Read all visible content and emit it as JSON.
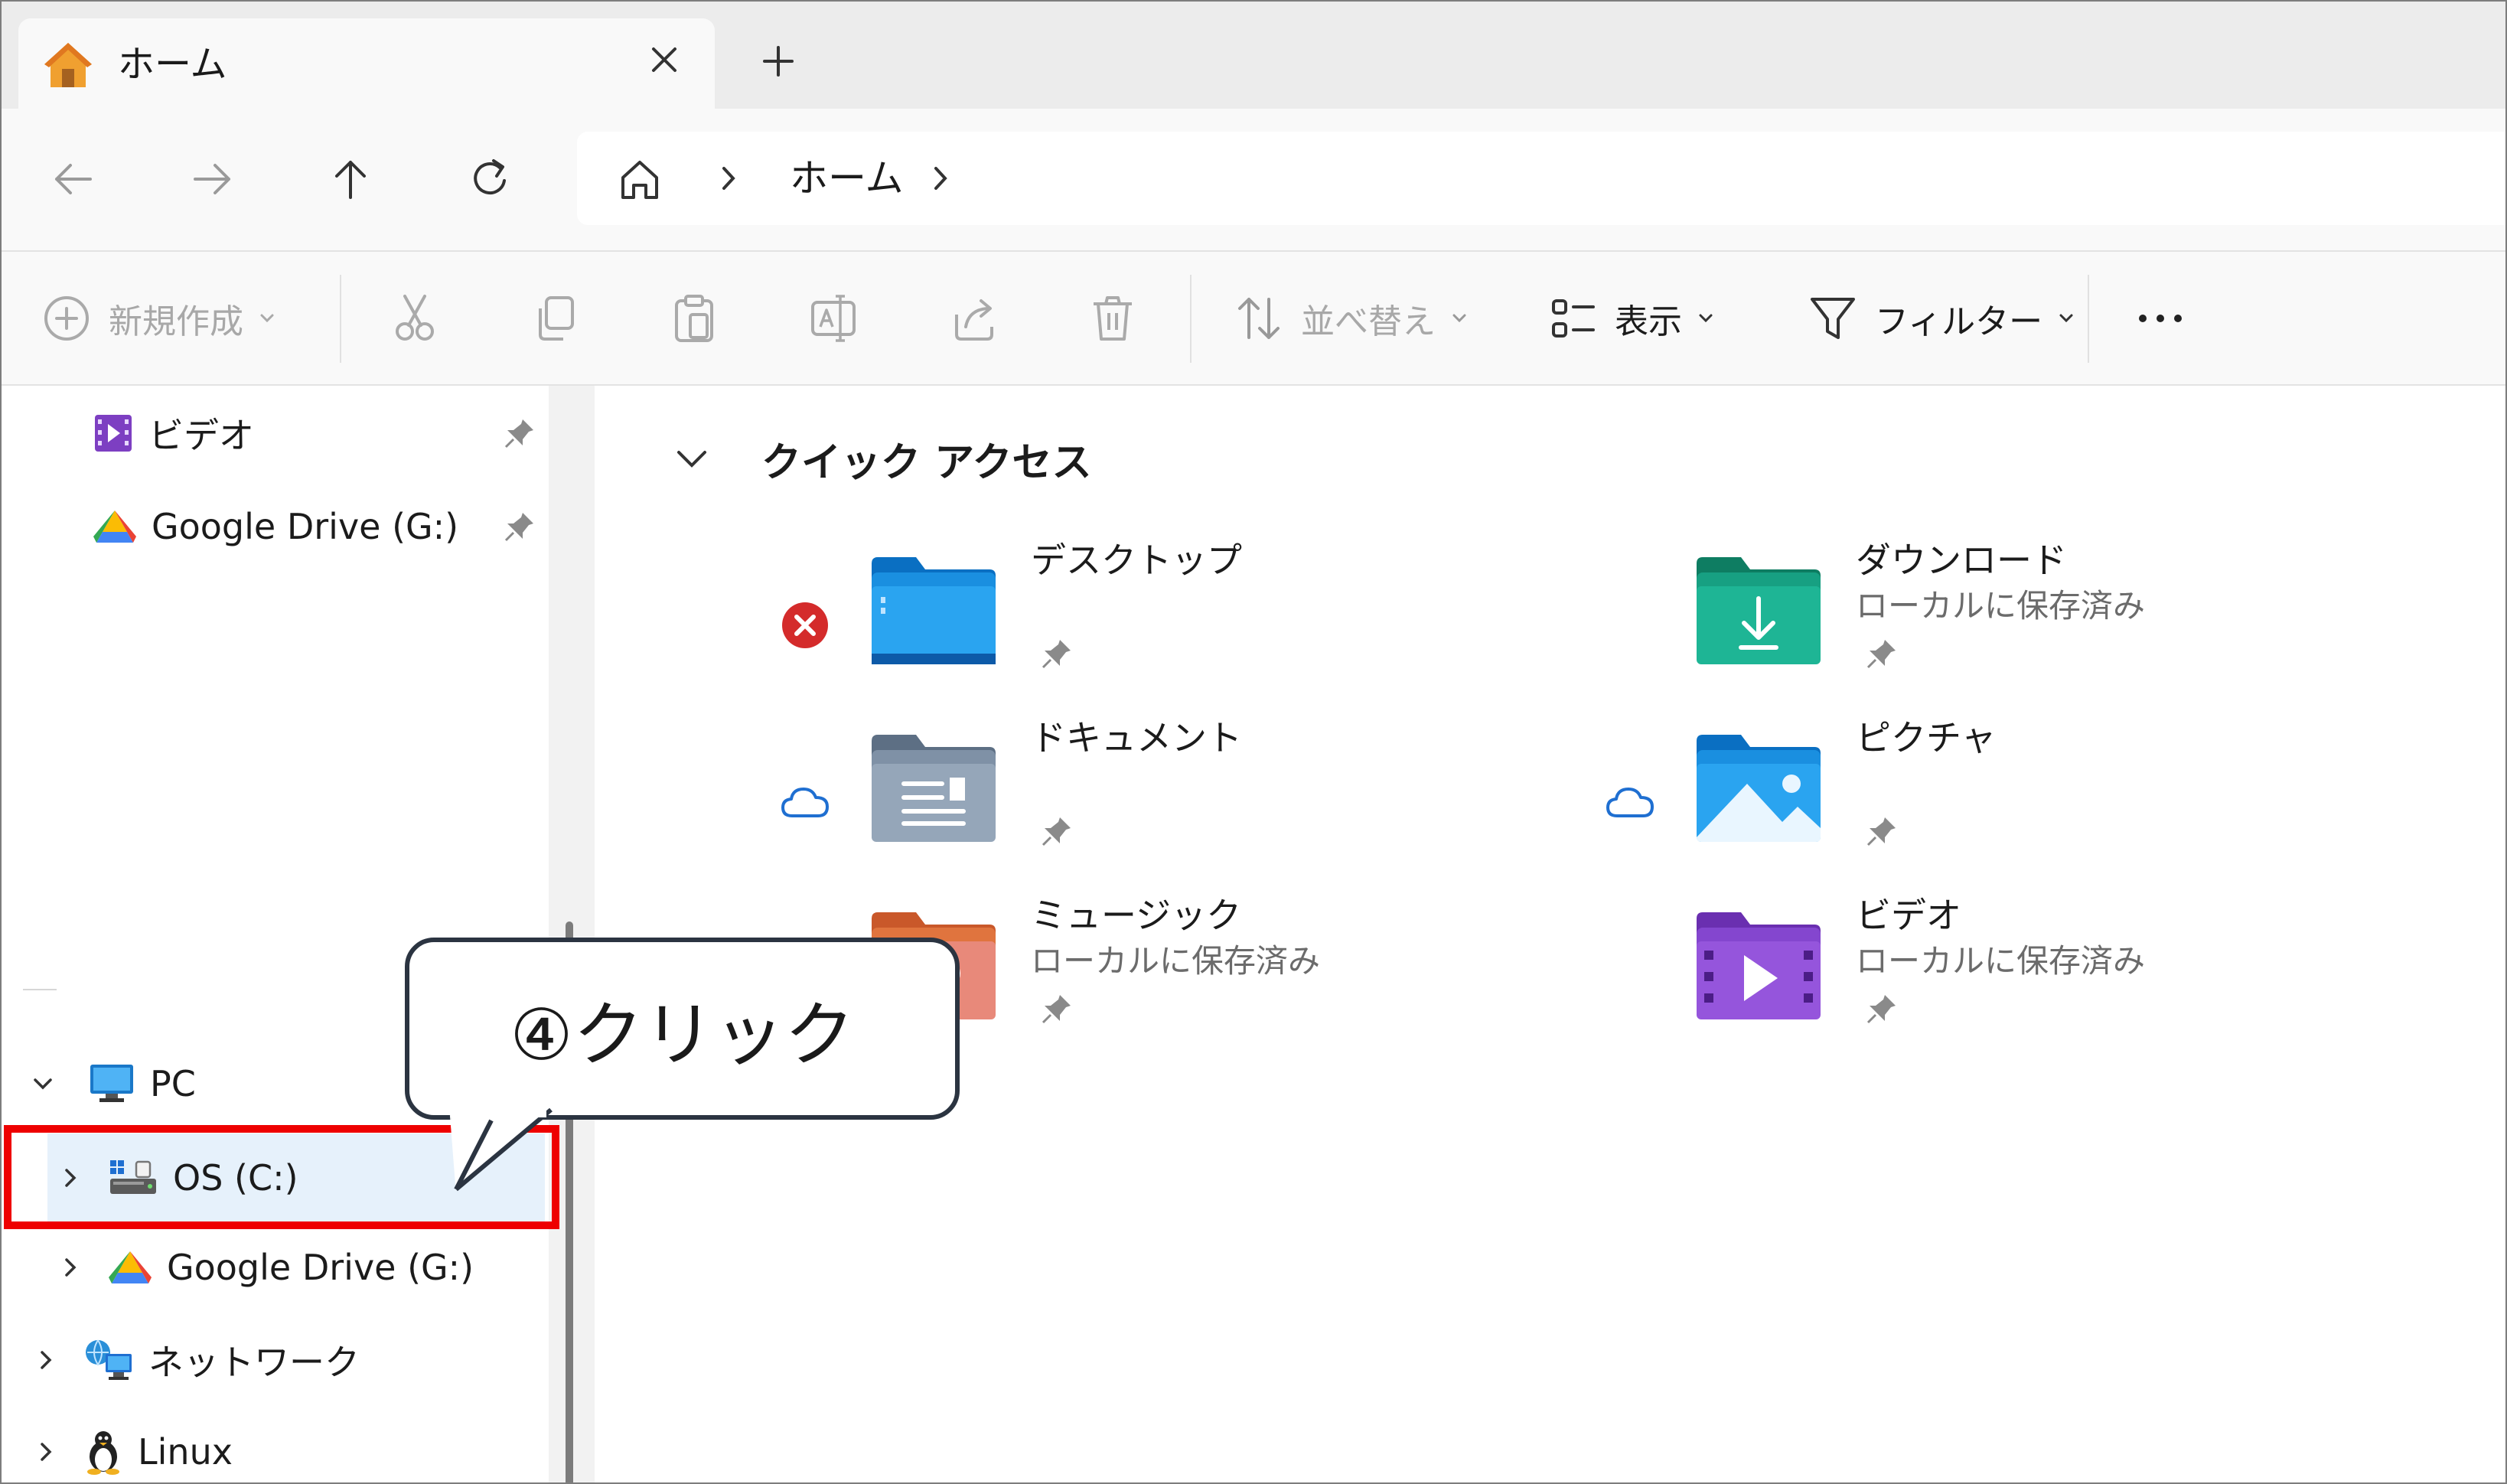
{
  "tab": {
    "title": "ホーム",
    "close_icon": "close-icon",
    "new_tab_icon": "plus-icon"
  },
  "nav": {
    "back_icon": "arrow-left-icon",
    "forward_icon": "arrow-right-icon",
    "up_icon": "arrow-up-icon",
    "refresh_icon": "refresh-icon",
    "address": {
      "home_icon": "home-icon",
      "current": "ホーム"
    }
  },
  "toolbar": {
    "new_label": "新規作成",
    "sort_label": "並べ替え",
    "view_label": "表示",
    "filter_label": "フィルター",
    "more_icon": "more-icon"
  },
  "sidebar": {
    "pinned": [
      {
        "label": "ビデオ",
        "icon": "video-folder-icon"
      },
      {
        "label": "Google Drive (G:)",
        "icon": "google-drive-icon"
      }
    ],
    "pc_label": "PC",
    "drives": [
      {
        "label": "OS (C:)",
        "icon": "drive-icon"
      },
      {
        "label": "Google Drive (G:)",
        "icon": "google-drive-icon"
      }
    ],
    "network_label": "ネットワーク",
    "linux_label": "Linux"
  },
  "quick_access": {
    "title": "クイック アクセス",
    "items": [
      {
        "name": "デスクトップ",
        "sub": "",
        "status": "error"
      },
      {
        "name": "ダウンロード",
        "sub": "ローカルに保存済み",
        "status": ""
      },
      {
        "name": "ドキュメント",
        "sub": "",
        "status": "cloud"
      },
      {
        "name": "ピクチャ",
        "sub": "",
        "status": "cloud"
      },
      {
        "name": "ミュージック",
        "sub": "ローカルに保存済み",
        "status": ""
      },
      {
        "name": "ビデオ",
        "sub": "ローカルに保存済み",
        "status": ""
      }
    ]
  },
  "annotation": {
    "text": "④クリック",
    "highlight_color": "#ee0000"
  }
}
